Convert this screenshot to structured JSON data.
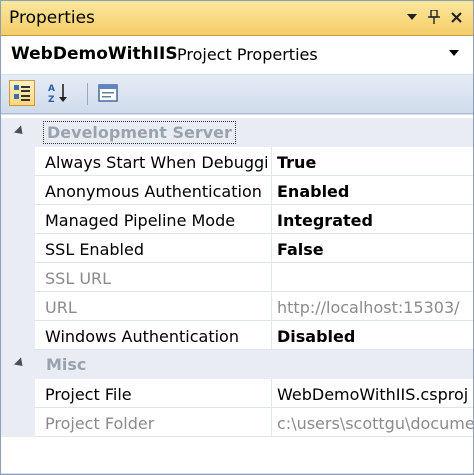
{
  "window": {
    "title": "Properties"
  },
  "object_selector": {
    "name": "WebDemoWithIIS",
    "type": "Project Properties"
  },
  "icons": {
    "dropdown": "dropdown-icon",
    "pin": "pin-icon",
    "close": "close-icon",
    "categorized": "categorized-icon",
    "alphabetical": "alphabetical-sort-icon",
    "property_pages": "property-pages-icon"
  },
  "categories": [
    {
      "name": "Development Server",
      "properties": [
        {
          "name": "Always Start When Debuggi",
          "value": "True",
          "bold": true,
          "dim": false
        },
        {
          "name": "Anonymous Authentication",
          "value": "Enabled",
          "bold": true,
          "dim": false
        },
        {
          "name": "Managed Pipeline Mode",
          "value": "Integrated",
          "bold": true,
          "dim": false
        },
        {
          "name": "SSL Enabled",
          "value": "False",
          "bold": true,
          "dim": false
        },
        {
          "name": "SSL URL",
          "value": "",
          "bold": false,
          "dim": true
        },
        {
          "name": "URL",
          "value": "http://localhost:15303/",
          "bold": false,
          "dim": true
        },
        {
          "name": "Windows Authentication",
          "value": "Disabled",
          "bold": true,
          "dim": false
        }
      ]
    },
    {
      "name": "Misc",
      "properties": [
        {
          "name": "Project File",
          "value": "WebDemoWithIIS.csproj",
          "bold": false,
          "dim": false
        },
        {
          "name": "Project Folder",
          "value": "c:\\users\\scottgu\\documents",
          "bold": false,
          "dim": true
        }
      ]
    }
  ]
}
